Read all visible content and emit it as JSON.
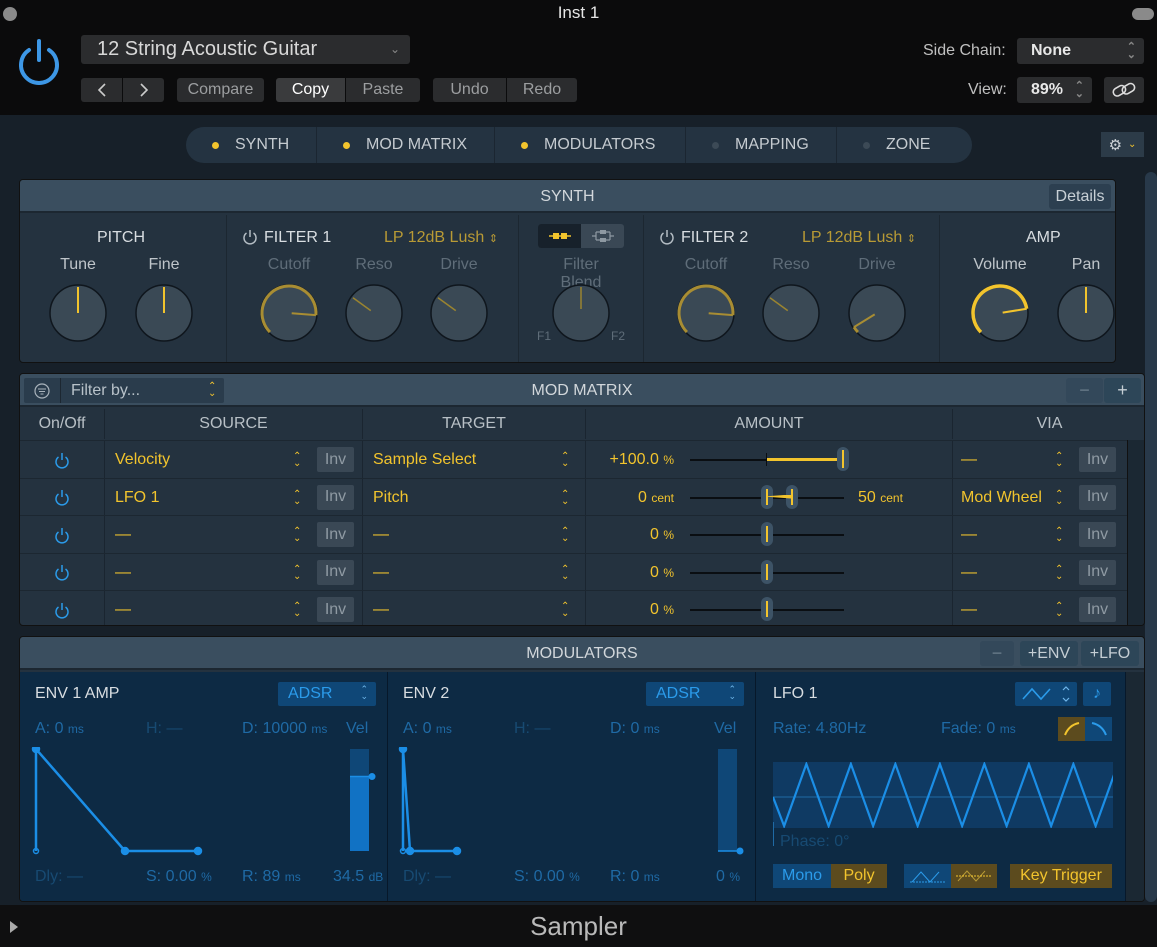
{
  "window": {
    "title": "Inst 1"
  },
  "header": {
    "preset": "12 String Acoustic Guitar",
    "prev_label": "<",
    "next_label": ">",
    "compare_label": "Compare",
    "copy_label": "Copy",
    "paste_label": "Paste",
    "undo_label": "Undo",
    "redo_label": "Redo",
    "side_chain_label": "Side Chain:",
    "side_chain_value": "None",
    "view_label": "View:",
    "view_value": "89%"
  },
  "tabs": [
    {
      "label": "SYNTH",
      "active": true
    },
    {
      "label": "MOD MATRIX",
      "active": true
    },
    {
      "label": "MODULATORS",
      "active": true
    },
    {
      "label": "MAPPING",
      "active": false
    },
    {
      "label": "ZONE",
      "active": false
    }
  ],
  "colors": {
    "accent_yellow": "#f2c42d",
    "accent_gold": "#b89a35",
    "accent_blue": "#2b9bea",
    "dot_off": "#3c4a56"
  },
  "synth": {
    "title": "SYNTH",
    "details_label": "Details",
    "pitch": {
      "title": "PITCH",
      "tune_label": "Tune",
      "fine_label": "Fine",
      "tune_value": 0.5,
      "fine_value": 0.5
    },
    "filter1": {
      "title": "FILTER 1",
      "type": "LP 12dB Lush",
      "cutoff_label": "Cutoff",
      "reso_label": "Reso",
      "drive_label": "Drive",
      "cutoff_value": 0.85,
      "reso_value": 0.3,
      "drive_value": 0.3
    },
    "blend": {
      "label": "Filter Blend",
      "f1": "F1",
      "f2": "F2",
      "value": 0.5
    },
    "filter2": {
      "title": "FILTER 2",
      "type": "LP 12dB Lush",
      "cutoff_label": "Cutoff",
      "reso_label": "Reso",
      "drive_label": "Drive",
      "cutoff_value": 0.85,
      "reso_value": 0.3,
      "drive_value": 0.05
    },
    "amp": {
      "title": "AMP",
      "volume_label": "Volume",
      "pan_label": "Pan",
      "volume_value": 0.8,
      "pan_value": 0.5
    }
  },
  "mod_matrix": {
    "title": "MOD MATRIX",
    "filter_placeholder": "Filter by...",
    "minus_label": "−",
    "plus_label": "+",
    "columns": [
      "On/Off",
      "SOURCE",
      "TARGET",
      "AMOUNT",
      "VIA"
    ],
    "inv_label": "Inv",
    "rows": [
      {
        "source": "Velocity",
        "target": "Sample Select",
        "amount": "+100.0",
        "unit": "%",
        "via": "—",
        "via_amount": "",
        "via_unit": ""
      },
      {
        "source": "LFO 1",
        "target": "Pitch",
        "amount": "0",
        "unit": "cent",
        "via": "Mod Wheel",
        "via_amount": "50",
        "via_unit": "cent"
      },
      {
        "source": "—",
        "target": "—",
        "amount": "0",
        "unit": "%",
        "via": "—",
        "via_amount": "",
        "via_unit": ""
      },
      {
        "source": "—",
        "target": "—",
        "amount": "0",
        "unit": "%",
        "via": "—",
        "via_amount": "",
        "via_unit": ""
      },
      {
        "source": "—",
        "target": "—",
        "amount": "0",
        "unit": "%",
        "via": "—",
        "via_amount": "",
        "via_unit": ""
      }
    ]
  },
  "modulators": {
    "title": "MODULATORS",
    "minus_label": "−",
    "add_env_label": "+ENV",
    "add_lfo_label": "+LFO",
    "env1": {
      "title": "ENV 1 AMP",
      "mode": "ADSR",
      "a": "A: 0",
      "a_unit": "ms",
      "h": "H: —",
      "d": "D: 10000",
      "d_unit": "ms",
      "vel_label": "Vel",
      "dly": "Dly: —",
      "s": "S: 0.00",
      "s_unit": "%",
      "r": "R: 89",
      "r_unit": "ms",
      "vel_value": "34.5",
      "vel_unit": "dB",
      "vel_fraction": 0.73
    },
    "env2": {
      "title": "ENV 2",
      "mode": "ADSR",
      "a": "A: 0",
      "a_unit": "ms",
      "h": "H: —",
      "d": "D: 0",
      "d_unit": "ms",
      "vel_label": "Vel",
      "dly": "Dly: —",
      "s": "S: 0.00",
      "s_unit": "%",
      "r": "R: 0",
      "r_unit": "ms",
      "vel_value": "0",
      "vel_unit": "%",
      "vel_fraction": 0.0
    },
    "lfo1": {
      "title": "LFO 1",
      "rate": "Rate: 4.80Hz",
      "fade": "Fade: 0",
      "fade_unit": "ms",
      "phase": "Phase: 0°",
      "mono_label": "Mono",
      "poly_label": "Poly",
      "key_trigger_label": "Key Trigger"
    }
  },
  "footer": {
    "title": "Sampler"
  }
}
